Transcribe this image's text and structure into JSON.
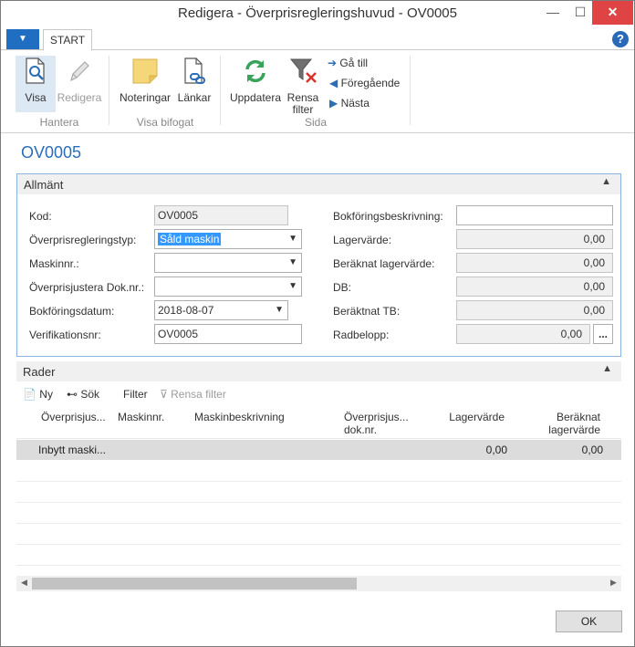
{
  "window": {
    "title": "Redigera - Överprisregleringshuvud - OV0005",
    "minimize": "—",
    "maximize": "☐",
    "close": "✕"
  },
  "ribbon": {
    "app_menu": "▼",
    "tab": "START",
    "help": "?",
    "groups": {
      "hantera": "Hantera",
      "visa_bifogat": "Visa bifogat",
      "sida": "Sida"
    },
    "buttons": {
      "visa": "Visa",
      "redigera": "Redigera",
      "noteringar": "Noteringar",
      "lankar": "Länkar",
      "uppdatera": "Uppdatera",
      "rensa_filter_1": "Rensa",
      "rensa_filter_2": "filter",
      "ga_till": "Gå till",
      "foregaende": "Föregående",
      "nasta": "Nästa"
    }
  },
  "page_title": "OV0005",
  "allmant": {
    "title": "Allmänt",
    "left": [
      {
        "label": "Kod:",
        "value": "OV0005"
      },
      {
        "label": "Överprisregleringstyp:",
        "value": "Såld maskin"
      },
      {
        "label": "Maskinnr.:",
        "value": ""
      },
      {
        "label": "Överprisjustera Dok.nr.:",
        "value": ""
      },
      {
        "label": "Bokföringsdatum:",
        "value": "2018-08-07"
      },
      {
        "label": "Verifikationsnr:",
        "value": "OV0005"
      }
    ],
    "right": [
      {
        "label": "Bokföringsbeskrivning:",
        "value": ""
      },
      {
        "label": "Lagervärde:",
        "value": "0,00"
      },
      {
        "label": "Beräknat lagervärde:",
        "value": "0,00"
      },
      {
        "label": "DB:",
        "value": "0,00"
      },
      {
        "label": "Beräktnat TB:",
        "value": "0,00"
      },
      {
        "label": "Radbelopp:",
        "value": "0,00"
      }
    ],
    "ellipsis": "..."
  },
  "rader": {
    "title": "Rader",
    "toolbar": {
      "ny": "Ny",
      "sok": "Sök",
      "filter": "Filter",
      "rensa_filter": "Rensa filter"
    },
    "columns": [
      [
        "Överprisjus..."
      ],
      [
        "Maskinnr."
      ],
      [
        "Maskinbeskrivning"
      ],
      [
        "Överprisjus...",
        "dok.nr."
      ],
      [
        "Lagervärde"
      ],
      [
        "Beräknat",
        "lagervärde"
      ]
    ],
    "rows": [
      {
        "col1": "Inbytt maski...",
        "col2": "",
        "col3": "",
        "col4": "",
        "lagervarde": "0,00",
        "beraknat": "0,00"
      }
    ]
  },
  "ok_button": "OK",
  "colors": {
    "accent": "#2b6eb5",
    "section_border": "#8ab3e3",
    "app_menu": "#1f6ec2",
    "close": "#e04343"
  }
}
